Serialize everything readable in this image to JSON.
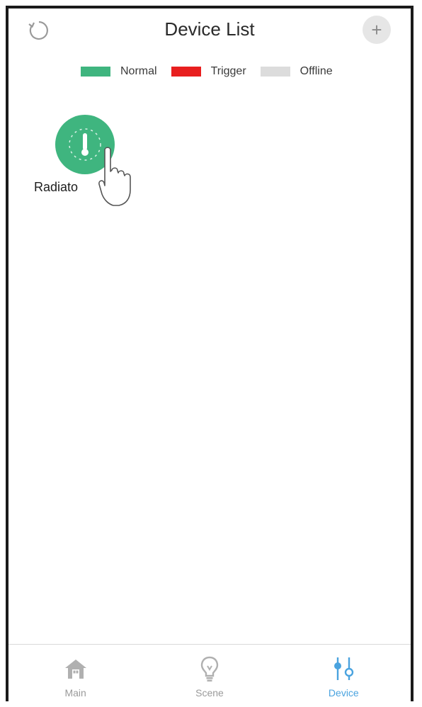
{
  "header": {
    "title": "Device List",
    "refresh_icon": "refresh-icon",
    "add_icon": "plus-icon",
    "add_label": "+"
  },
  "legend": [
    {
      "label": "Normal",
      "color": "#3fb57f"
    },
    {
      "label": "Trigger",
      "color": "#e81f1f"
    },
    {
      "label": "Offline",
      "color": "#dcdcdc"
    }
  ],
  "devices": [
    {
      "label": "Radiato",
      "status": "Normal",
      "icon": "thermometer-icon",
      "color": "#3fb57f"
    }
  ],
  "tabs": [
    {
      "label": "Main",
      "icon": "home-icon",
      "active": false
    },
    {
      "label": "Scene",
      "icon": "lightbulb-icon",
      "active": false
    },
    {
      "label": "Device",
      "icon": "sliders-icon",
      "active": true
    }
  ],
  "colors": {
    "active_tab": "#4aa3df",
    "inactive_tab": "#9a9a9a"
  }
}
